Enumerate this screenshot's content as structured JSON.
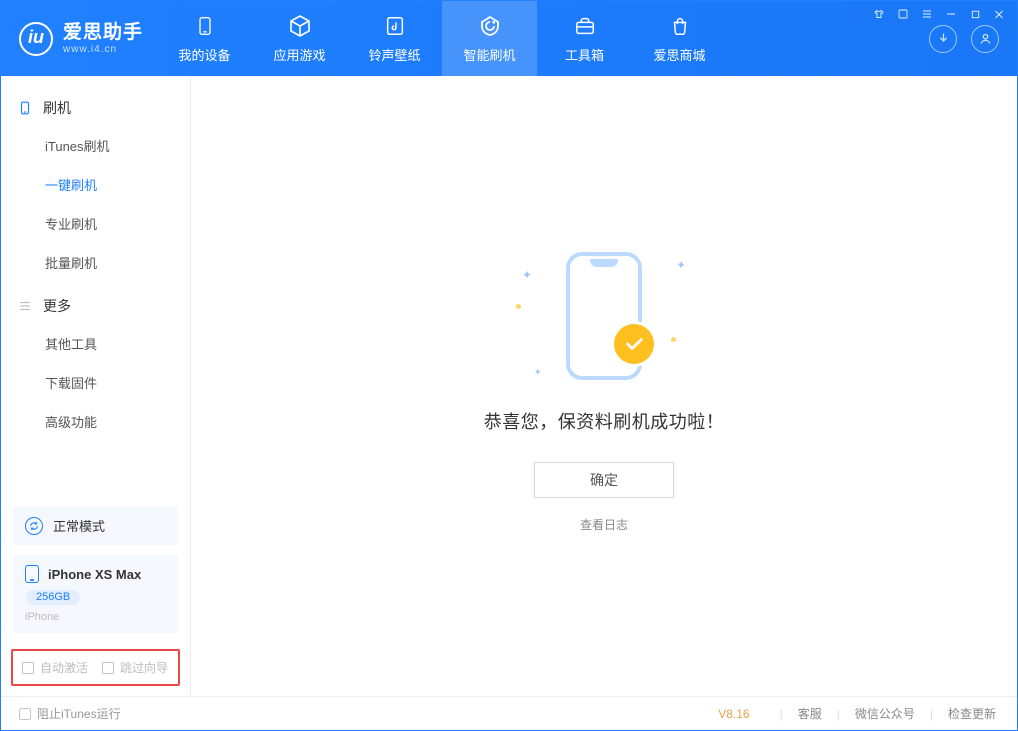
{
  "app": {
    "name_cn": "爱思助手",
    "name_en": "www.i4.cn"
  },
  "tabs": {
    "device": "我的设备",
    "apps": "应用游戏",
    "ringtones": "铃声壁纸",
    "flash": "智能刷机",
    "toolbox": "工具箱",
    "store": "爱思商城"
  },
  "sidebar": {
    "group_flash": "刷机",
    "items_flash": {
      "itunes": "iTunes刷机",
      "oneclick": "一键刷机",
      "pro": "专业刷机",
      "batch": "批量刷机"
    },
    "group_more": "更多",
    "items_more": {
      "other_tools": "其他工具",
      "download_fw": "下载固件",
      "advanced": "高级功能"
    },
    "mode_label": "正常模式",
    "device_name": "iPhone XS Max",
    "device_storage": "256GB",
    "device_type": "iPhone",
    "auto_activate": "自动激活",
    "skip_wizard": "跳过向导"
  },
  "main": {
    "success_msg": "恭喜您，保资料刷机成功啦！",
    "ok": "确定",
    "view_log": "查看日志"
  },
  "footer": {
    "block_itunes": "阻止iTunes运行",
    "version": "V8.16",
    "support": "客服",
    "wechat": "微信公众号",
    "check_update": "检查更新"
  }
}
